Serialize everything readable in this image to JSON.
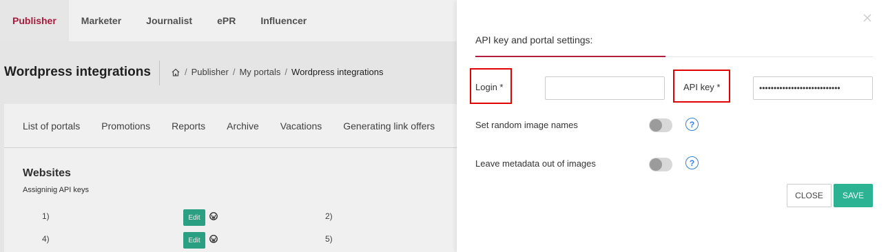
{
  "topnav": {
    "tabs": [
      {
        "label": "Publisher",
        "active": true
      },
      {
        "label": "Marketer"
      },
      {
        "label": "Journalist"
      },
      {
        "label": "ePR"
      },
      {
        "label": "Influencer"
      }
    ]
  },
  "header": {
    "title": "Wordpress integrations",
    "breadcrumb": [
      "Publisher",
      "My portals",
      "Wordpress integrations"
    ]
  },
  "subnav": [
    "List of portals",
    "Promotions",
    "Reports",
    "Archive",
    "Vacations",
    "Generating link offers"
  ],
  "websites": {
    "title": "Websites",
    "subtitle": "Assigninig API keys",
    "rows": [
      {
        "left_num": "1)",
        "right_num": "2)",
        "edit_label": "Edit"
      },
      {
        "left_num": "4)",
        "right_num": "5)",
        "edit_label": "Edit"
      }
    ]
  },
  "panel": {
    "title": "API key and portal settings:",
    "login_label": "Login *",
    "login_value": "",
    "apikey_label": "API key *",
    "apikey_value": "••••••••••••••••••••••••••••",
    "random_names_label": "Set random image names",
    "metadata_label": "Leave metadata out of images",
    "help_glyph": "?",
    "close_label": "CLOSE",
    "save_label": "SAVE"
  },
  "colors": {
    "accent": "#b11c3f",
    "button_green": "#2bb394",
    "edit_green": "#2ea98a",
    "highlight_red": "#e00000",
    "help_blue": "#2f7fe0"
  }
}
